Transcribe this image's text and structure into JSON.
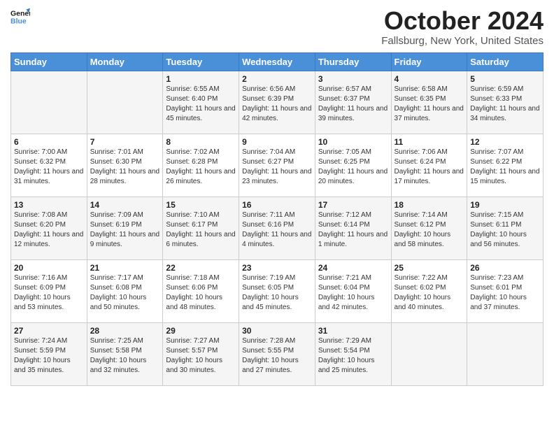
{
  "logo": {
    "text_general": "General",
    "text_blue": "Blue"
  },
  "header": {
    "title": "October 2024",
    "subtitle": "Fallsburg, New York, United States"
  },
  "days_of_week": [
    "Sunday",
    "Monday",
    "Tuesday",
    "Wednesday",
    "Thursday",
    "Friday",
    "Saturday"
  ],
  "weeks": [
    [
      {
        "day": "",
        "sunrise": "",
        "sunset": "",
        "daylight": ""
      },
      {
        "day": "",
        "sunrise": "",
        "sunset": "",
        "daylight": ""
      },
      {
        "day": "1",
        "sunrise": "Sunrise: 6:55 AM",
        "sunset": "Sunset: 6:40 PM",
        "daylight": "Daylight: 11 hours and 45 minutes."
      },
      {
        "day": "2",
        "sunrise": "Sunrise: 6:56 AM",
        "sunset": "Sunset: 6:39 PM",
        "daylight": "Daylight: 11 hours and 42 minutes."
      },
      {
        "day": "3",
        "sunrise": "Sunrise: 6:57 AM",
        "sunset": "Sunset: 6:37 PM",
        "daylight": "Daylight: 11 hours and 39 minutes."
      },
      {
        "day": "4",
        "sunrise": "Sunrise: 6:58 AM",
        "sunset": "Sunset: 6:35 PM",
        "daylight": "Daylight: 11 hours and 37 minutes."
      },
      {
        "day": "5",
        "sunrise": "Sunrise: 6:59 AM",
        "sunset": "Sunset: 6:33 PM",
        "daylight": "Daylight: 11 hours and 34 minutes."
      }
    ],
    [
      {
        "day": "6",
        "sunrise": "Sunrise: 7:00 AM",
        "sunset": "Sunset: 6:32 PM",
        "daylight": "Daylight: 11 hours and 31 minutes."
      },
      {
        "day": "7",
        "sunrise": "Sunrise: 7:01 AM",
        "sunset": "Sunset: 6:30 PM",
        "daylight": "Daylight: 11 hours and 28 minutes."
      },
      {
        "day": "8",
        "sunrise": "Sunrise: 7:02 AM",
        "sunset": "Sunset: 6:28 PM",
        "daylight": "Daylight: 11 hours and 26 minutes."
      },
      {
        "day": "9",
        "sunrise": "Sunrise: 7:04 AM",
        "sunset": "Sunset: 6:27 PM",
        "daylight": "Daylight: 11 hours and 23 minutes."
      },
      {
        "day": "10",
        "sunrise": "Sunrise: 7:05 AM",
        "sunset": "Sunset: 6:25 PM",
        "daylight": "Daylight: 11 hours and 20 minutes."
      },
      {
        "day": "11",
        "sunrise": "Sunrise: 7:06 AM",
        "sunset": "Sunset: 6:24 PM",
        "daylight": "Daylight: 11 hours and 17 minutes."
      },
      {
        "day": "12",
        "sunrise": "Sunrise: 7:07 AM",
        "sunset": "Sunset: 6:22 PM",
        "daylight": "Daylight: 11 hours and 15 minutes."
      }
    ],
    [
      {
        "day": "13",
        "sunrise": "Sunrise: 7:08 AM",
        "sunset": "Sunset: 6:20 PM",
        "daylight": "Daylight: 11 hours and 12 minutes."
      },
      {
        "day": "14",
        "sunrise": "Sunrise: 7:09 AM",
        "sunset": "Sunset: 6:19 PM",
        "daylight": "Daylight: 11 hours and 9 minutes."
      },
      {
        "day": "15",
        "sunrise": "Sunrise: 7:10 AM",
        "sunset": "Sunset: 6:17 PM",
        "daylight": "Daylight: 11 hours and 6 minutes."
      },
      {
        "day": "16",
        "sunrise": "Sunrise: 7:11 AM",
        "sunset": "Sunset: 6:16 PM",
        "daylight": "Daylight: 11 hours and 4 minutes."
      },
      {
        "day": "17",
        "sunrise": "Sunrise: 7:12 AM",
        "sunset": "Sunset: 6:14 PM",
        "daylight": "Daylight: 11 hours and 1 minute."
      },
      {
        "day": "18",
        "sunrise": "Sunrise: 7:14 AM",
        "sunset": "Sunset: 6:12 PM",
        "daylight": "Daylight: 10 hours and 58 minutes."
      },
      {
        "day": "19",
        "sunrise": "Sunrise: 7:15 AM",
        "sunset": "Sunset: 6:11 PM",
        "daylight": "Daylight: 10 hours and 56 minutes."
      }
    ],
    [
      {
        "day": "20",
        "sunrise": "Sunrise: 7:16 AM",
        "sunset": "Sunset: 6:09 PM",
        "daylight": "Daylight: 10 hours and 53 minutes."
      },
      {
        "day": "21",
        "sunrise": "Sunrise: 7:17 AM",
        "sunset": "Sunset: 6:08 PM",
        "daylight": "Daylight: 10 hours and 50 minutes."
      },
      {
        "day": "22",
        "sunrise": "Sunrise: 7:18 AM",
        "sunset": "Sunset: 6:06 PM",
        "daylight": "Daylight: 10 hours and 48 minutes."
      },
      {
        "day": "23",
        "sunrise": "Sunrise: 7:19 AM",
        "sunset": "Sunset: 6:05 PM",
        "daylight": "Daylight: 10 hours and 45 minutes."
      },
      {
        "day": "24",
        "sunrise": "Sunrise: 7:21 AM",
        "sunset": "Sunset: 6:04 PM",
        "daylight": "Daylight: 10 hours and 42 minutes."
      },
      {
        "day": "25",
        "sunrise": "Sunrise: 7:22 AM",
        "sunset": "Sunset: 6:02 PM",
        "daylight": "Daylight: 10 hours and 40 minutes."
      },
      {
        "day": "26",
        "sunrise": "Sunrise: 7:23 AM",
        "sunset": "Sunset: 6:01 PM",
        "daylight": "Daylight: 10 hours and 37 minutes."
      }
    ],
    [
      {
        "day": "27",
        "sunrise": "Sunrise: 7:24 AM",
        "sunset": "Sunset: 5:59 PM",
        "daylight": "Daylight: 10 hours and 35 minutes."
      },
      {
        "day": "28",
        "sunrise": "Sunrise: 7:25 AM",
        "sunset": "Sunset: 5:58 PM",
        "daylight": "Daylight: 10 hours and 32 minutes."
      },
      {
        "day": "29",
        "sunrise": "Sunrise: 7:27 AM",
        "sunset": "Sunset: 5:57 PM",
        "daylight": "Daylight: 10 hours and 30 minutes."
      },
      {
        "day": "30",
        "sunrise": "Sunrise: 7:28 AM",
        "sunset": "Sunset: 5:55 PM",
        "daylight": "Daylight: 10 hours and 27 minutes."
      },
      {
        "day": "31",
        "sunrise": "Sunrise: 7:29 AM",
        "sunset": "Sunset: 5:54 PM",
        "daylight": "Daylight: 10 hours and 25 minutes."
      },
      {
        "day": "",
        "sunrise": "",
        "sunset": "",
        "daylight": ""
      },
      {
        "day": "",
        "sunrise": "",
        "sunset": "",
        "daylight": ""
      }
    ]
  ]
}
